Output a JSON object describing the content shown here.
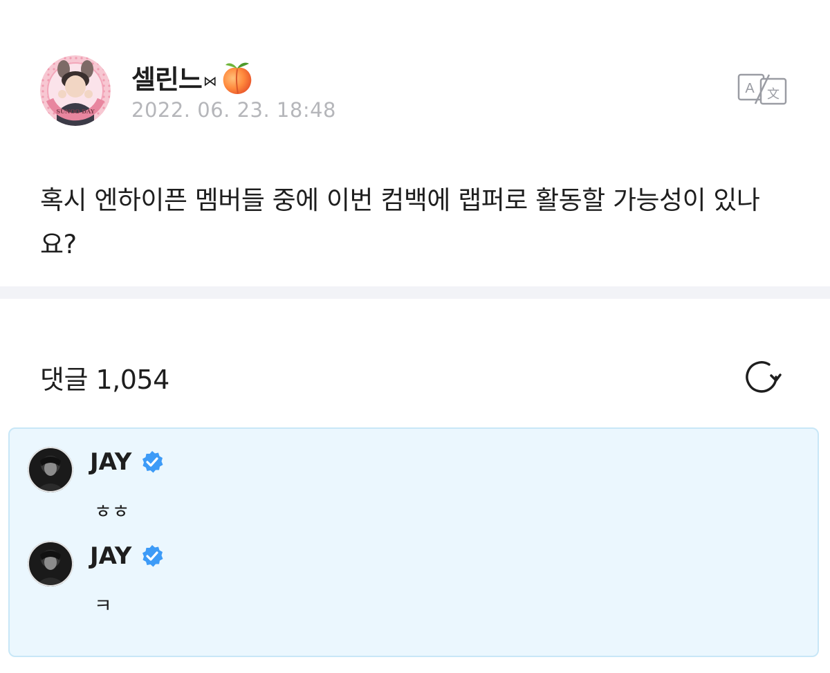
{
  "post": {
    "author_name": "셀린느",
    "author_bow": "⋈",
    "peach_icon": "peach-emoji-icon",
    "date": "2022. 06. 23. 18:48",
    "body": "혹시 엔하이픈 멤버들 중에 이번 컴백에 랩퍼로 활동할 가능성이 있나요?",
    "avatar_badge_text": "SUNOO DAY",
    "translate_icon": "translate-icon"
  },
  "comments_section": {
    "label": "댓글 1,054",
    "refresh_icon": "refresh-icon"
  },
  "comments": [
    {
      "author": "JAY",
      "verified": true,
      "text": "ㅎㅎ"
    },
    {
      "author": "JAY",
      "verified": true,
      "text": "ㅋ"
    }
  ],
  "colors": {
    "date_gray": "#b5b6ba",
    "comment_bg": "#ebf7fe",
    "comment_border": "#c8e7f7",
    "verified_blue": "#3d9bf7",
    "divider": "#f2f3f7"
  }
}
